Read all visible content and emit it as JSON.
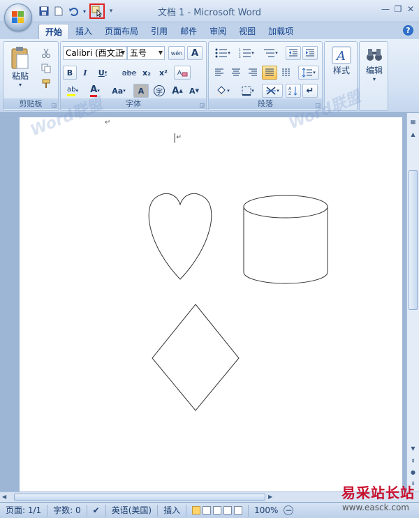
{
  "window": {
    "title": "文档 1 - Microsoft Word",
    "minimize": "—",
    "restore": "❐",
    "close": "✕"
  },
  "tabs": [
    "开始",
    "插入",
    "页面布局",
    "引用",
    "邮件",
    "审阅",
    "视图",
    "加载项"
  ],
  "help": "?",
  "ribbon": {
    "clipboard": {
      "label": "剪贴板",
      "paste": "粘贴"
    },
    "font": {
      "label": "字体",
      "font_name": "Calibri (西文正",
      "font_size": "五号",
      "bold": "B",
      "italic": "I",
      "underline": "U",
      "strike": "abe",
      "subscript": "x₂",
      "superscript": "x²",
      "highlight": "ab",
      "font_color": "A",
      "change_case": "Aa",
      "char_shading": "A",
      "enclose": "字",
      "grow": "A",
      "shrink": "A",
      "clear_format": "A",
      "phonetic": "wén"
    },
    "paragraph": {
      "label": "段落"
    },
    "styles": {
      "label": "样式"
    },
    "editing": {
      "label": "编辑"
    }
  },
  "document": {
    "cursor_mark": "↵",
    "shapes": [
      "heart",
      "cylinder",
      "diamond"
    ]
  },
  "statusbar": {
    "page": "页面: 1/1",
    "words": "字数: 0",
    "language": "英语(美国)",
    "mode": "插入",
    "zoom": "100%"
  },
  "watermark": {
    "site": "易采站长站",
    "url": "www.easck.com",
    "faint": "Word联盟"
  },
  "colors": {
    "highlight_color": "#e02020",
    "accent": "#15428b"
  }
}
